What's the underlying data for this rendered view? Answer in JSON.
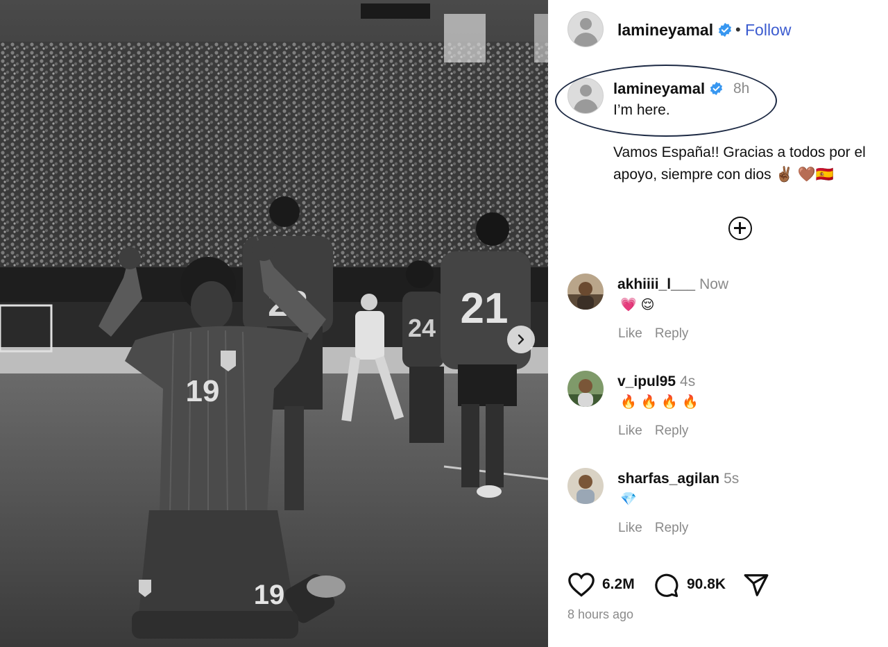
{
  "post": {
    "username": "lamineyamal",
    "follow_label": "Follow",
    "separator": "•"
  },
  "caption": {
    "username": "lamineyamal",
    "time": "8h",
    "reply_text": "I’m here.",
    "body": "Vamos España!! Gracias a todos por el apoyo, siempre con dios ✌🏾 🤎🇪🇸"
  },
  "comments": [
    {
      "username": "akhiiii_l___",
      "time": "Now",
      "text": "💗😌",
      "like": "Like",
      "reply": "Reply"
    },
    {
      "username": "v_ipul95",
      "time": "4s",
      "text": "🔥🔥🔥🔥",
      "like": "Like",
      "reply": "Reply"
    },
    {
      "username": "sharfas_agilan",
      "time": "5s",
      "text": "💎",
      "like": "Like",
      "reply": "Reply"
    }
  ],
  "stats": {
    "likes": "6.2M",
    "comments": "90.8K",
    "posted": "8 hours ago"
  },
  "photo": {
    "jersey_front": "19",
    "jersey_back_1": "22",
    "jersey_back_2": "21",
    "jersey_back_3": "24"
  },
  "colors": {
    "follow": "#3b5bcf",
    "verified": "#3897f0",
    "muted": "#8a8a8a"
  }
}
